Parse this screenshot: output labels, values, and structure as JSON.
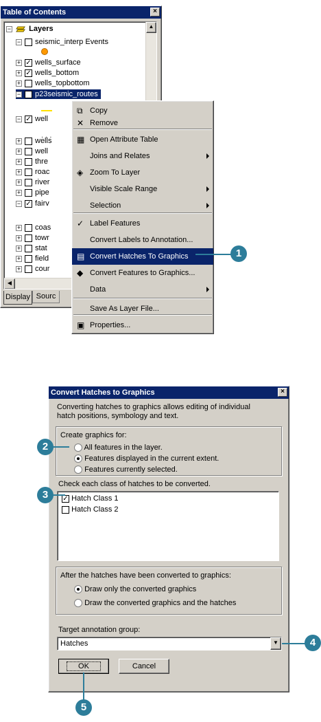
{
  "toc": {
    "title": "Table of Contents",
    "layers_label": "Layers",
    "items": [
      {
        "label": "seismic_interp Events",
        "checked": false,
        "expander": "−"
      },
      {
        "label": "wells_surface",
        "checked": true,
        "expander": "+"
      },
      {
        "label": "wells_bottom",
        "checked": true,
        "expander": "+"
      },
      {
        "label": "wells_topbottom",
        "checked": false,
        "expander": "+"
      },
      {
        "label": "p23seismic_routes",
        "checked": true,
        "expander": "−"
      },
      {
        "label": "well",
        "checked": true,
        "expander": "−"
      },
      {
        "label": "wells",
        "checked": false,
        "expander": "+"
      },
      {
        "label": "well",
        "checked": false,
        "expander": "+"
      },
      {
        "label": "thre",
        "checked": false,
        "expander": "+"
      },
      {
        "label": "roac",
        "checked": false,
        "expander": "+"
      },
      {
        "label": "river",
        "checked": false,
        "expander": "+"
      },
      {
        "label": "pipe",
        "checked": false,
        "expander": "+"
      },
      {
        "label": "fairv",
        "checked": true,
        "expander": "−"
      },
      {
        "label": "coas",
        "checked": false,
        "expander": "+"
      },
      {
        "label": "towr",
        "checked": false,
        "expander": "+"
      },
      {
        "label": "stat",
        "checked": false,
        "expander": "+"
      },
      {
        "label": "field",
        "checked": false,
        "expander": "+"
      },
      {
        "label": "cour",
        "checked": false,
        "expander": "+"
      }
    ],
    "tabs": [
      "Display",
      "Sourc"
    ]
  },
  "context_menu": {
    "items": [
      "Copy",
      "Remove",
      "Open Attribute Table",
      "Joins and Relates",
      "Zoom To Layer",
      "Visible Scale Range",
      "Selection",
      "Label Features",
      "Convert Labels to Annotation...",
      "Convert Hatches To Graphics",
      "Convert Features to Graphics...",
      "Data",
      "Save As Layer File...",
      "Properties..."
    ]
  },
  "dialog": {
    "title": "Convert Hatches to Graphics",
    "description": "Converting hatches to graphics allows editing of individual hatch positions, symbology and text.",
    "create_label": "Create graphics for:",
    "create_options": [
      "All features in the layer.",
      "Features displayed in the current extent.",
      "Features currently selected."
    ],
    "check_label": "Check each class of hatches to be converted.",
    "classes": [
      {
        "label": "Hatch Class 1",
        "checked": true
      },
      {
        "label": "Hatch Class 2",
        "checked": false
      }
    ],
    "after_label": "After the hatches have been converted to graphics:",
    "after_options": [
      "Draw only the converted graphics",
      "Draw the converted graphics and the hatches"
    ],
    "target_label": "Target annotation group:",
    "target_value": "Hatches",
    "ok_label": "OK",
    "cancel_label": "Cancel"
  },
  "callouts": [
    "1",
    "2",
    "3",
    "4",
    "5"
  ],
  "colors": {
    "callout": "#2d7d9a",
    "title_bar": "#0a246a",
    "face": "#d4d0c8"
  }
}
